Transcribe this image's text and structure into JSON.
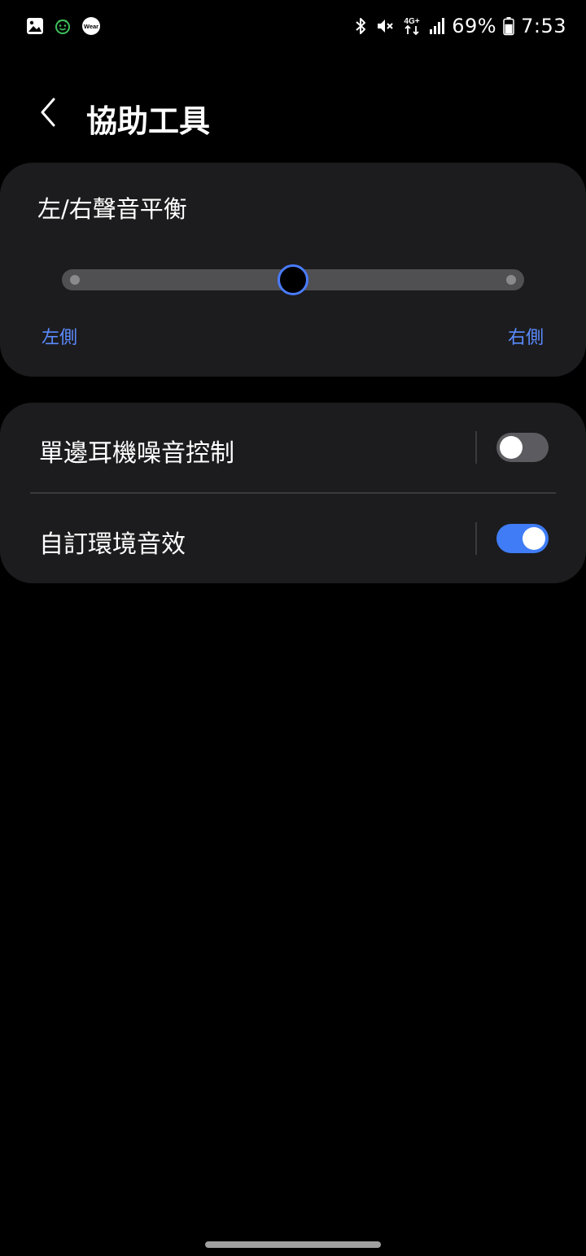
{
  "status_bar": {
    "left_icons": [
      "gallery-icon",
      "face-emoji-icon",
      "wear-icon"
    ],
    "wear_text": "Wear",
    "network_label": "4G+",
    "battery_percent": "69%",
    "battery_level": 69,
    "time": "7:53",
    "right_icons": [
      "bluetooth-icon",
      "mute-icon",
      "network-4g-icon",
      "signal-icon",
      "battery-icon"
    ]
  },
  "header": {
    "title": "協助工具",
    "back_icon": "chevron-left-icon"
  },
  "balance": {
    "title": "左/右聲音平衡",
    "left_label": "左側",
    "right_label": "右側",
    "value_percent": 50
  },
  "options": [
    {
      "label": "單邊耳機噪音控制",
      "enabled": false
    },
    {
      "label": "自訂環境音效",
      "enabled": true
    }
  ],
  "colors": {
    "background": "#000000",
    "card": "#1c1c1e",
    "accent": "#3f7cf5",
    "accent_text": "#5a8bff",
    "toggle_off": "#5c5c60"
  }
}
